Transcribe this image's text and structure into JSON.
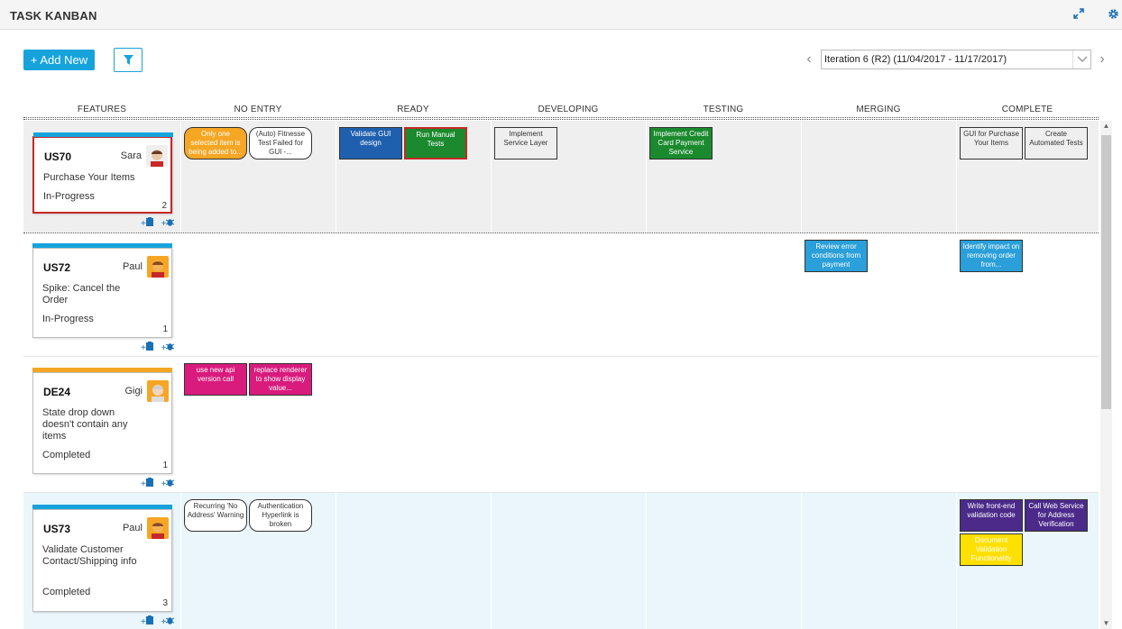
{
  "app": {
    "title": "TASK KANBAN",
    "expand_icon": "expand-icon",
    "settings_icon": "gear-icon"
  },
  "toolbar": {
    "add_label": "+ Add New",
    "filter_icon": "filter-icon",
    "iteration_selected": "Iteration 6 (R2) (11/04/2017 - 11/17/2017)"
  },
  "columns": [
    "FEATURES",
    "NO ENTRY",
    "READY",
    "DEVELOPING",
    "TESTING",
    "MERGING",
    "COMPLETE"
  ],
  "stories": [
    {
      "id": "US70",
      "owner": "Sara",
      "title": "Purchase Your Items",
      "status": "In-Progress",
      "count": "2",
      "bar_color": "#16a3dc"
    },
    {
      "id": "US72",
      "owner": "Paul",
      "title": "Spike: Cancel the Order",
      "status": "In-Progress",
      "count": "1",
      "bar_color": "#16a3dc"
    },
    {
      "id": "DE24",
      "owner": "Gigi",
      "title": "State drop down doesn't contain any items",
      "status": "Completed",
      "count": "1",
      "bar_color": "#f5a623"
    },
    {
      "id": "US73",
      "owner": "Paul",
      "title": "Validate Customer Contact/Shipping info",
      "status": "Completed",
      "count": "3",
      "bar_color": "#16a3dc"
    }
  ],
  "story_actions": {
    "add_task": "+",
    "add_defect": "+"
  },
  "tasks": [
    {
      "lane": 0,
      "col": 1,
      "slot": 0,
      "text": "Only one selected item is being added to...",
      "bg": "#f5a623",
      "fg": "#ffffff",
      "rounded": true
    },
    {
      "lane": 0,
      "col": 1,
      "slot": 1,
      "text": "(Auto) Fitnesse Test Failed for GUI -...",
      "bg": "#ffffff",
      "fg": "#333333",
      "rounded": true
    },
    {
      "lane": 0,
      "col": 2,
      "slot": 0,
      "text": "Validate GUI design",
      "bg": "#1e5fae",
      "fg": "#ffffff"
    },
    {
      "lane": 0,
      "col": 2,
      "slot": 1,
      "text": "Run Manual Tests",
      "bg": "#1b8a2e",
      "fg": "#ffffff",
      "border": "#c62828"
    },
    {
      "lane": 0,
      "col": 3,
      "slot": 0,
      "text": "Implement Service Layer",
      "bg": "#efefef",
      "fg": "#333333"
    },
    {
      "lane": 0,
      "col": 4,
      "slot": 0,
      "text": "Implement Credit Card Payment Service",
      "bg": "#1b8a2e",
      "fg": "#ffffff"
    },
    {
      "lane": 0,
      "col": 6,
      "slot": 0,
      "text": "GUI for Purchase Your Items",
      "bg": "#efefef",
      "fg": "#333333"
    },
    {
      "lane": 0,
      "col": 6,
      "slot": 1,
      "text": "Create Automated Tests",
      "bg": "#efefef",
      "fg": "#333333"
    },
    {
      "lane": 1,
      "col": 5,
      "slot": 0,
      "text": "Review error conditions from payment",
      "bg": "#2a9fd9",
      "fg": "#ffffff"
    },
    {
      "lane": 1,
      "col": 6,
      "slot": 0,
      "text": "Identify impact on removing order from...",
      "bg": "#2a9fd9",
      "fg": "#ffffff"
    },
    {
      "lane": 2,
      "col": 1,
      "slot": 0,
      "text": "use new api version call",
      "bg": "#d81b7d",
      "fg": "#ffffff"
    },
    {
      "lane": 2,
      "col": 1,
      "slot": 1,
      "text": "replace renderer to show display value...",
      "bg": "#d81b7d",
      "fg": "#ffffff"
    },
    {
      "lane": 3,
      "col": 1,
      "slot": 0,
      "text": "Recurring 'No Address' Warning",
      "bg": "#ffffff",
      "fg": "#333333",
      "rounded": true
    },
    {
      "lane": 3,
      "col": 1,
      "slot": 1,
      "text": "Authentication Hyperlink is broken",
      "bg": "#ffffff",
      "fg": "#333333",
      "rounded": true
    },
    {
      "lane": 3,
      "col": 6,
      "slot": 0,
      "text": "Write front-end validation code",
      "bg": "#4b2a8a",
      "fg": "#ffffff"
    },
    {
      "lane": 3,
      "col": 6,
      "slot": 1,
      "text": "Call Web Service for Address Verification",
      "bg": "#4b2a8a",
      "fg": "#ffffff"
    },
    {
      "lane": 3,
      "col": 6,
      "slot": 2,
      "text": "Document Validation Functionality",
      "bg": "#ffe000",
      "fg": "#ffffff"
    }
  ]
}
